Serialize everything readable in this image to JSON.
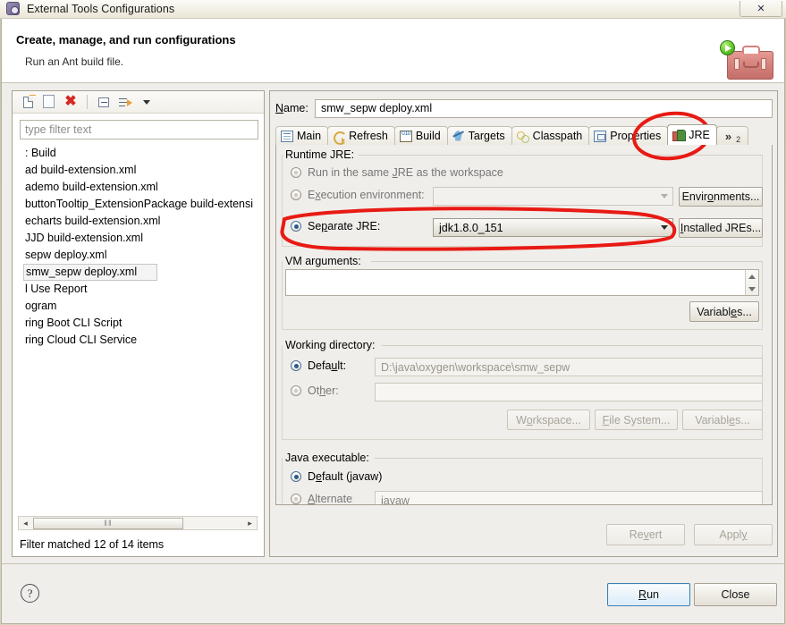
{
  "window": {
    "title": "External Tools Configurations",
    "icon": "gear-icon",
    "close_label": "✕"
  },
  "header": {
    "title": "Create, manage, and run configurations",
    "subtitle": "Run an Ant build file.",
    "hero_icon": "toolbox-with-run-icon"
  },
  "left_panel": {
    "toolbar": [
      {
        "name": "new-configuration-icon",
        "glyph": "new-doc"
      },
      {
        "name": "duplicate-configuration-icon",
        "glyph": "copy"
      },
      {
        "name": "delete-configuration-icon",
        "glyph": "red-x"
      },
      {
        "name": "collapse-all-icon",
        "glyph": "collapse"
      },
      {
        "name": "filter-configurations-icon",
        "glyph": "filter"
      },
      {
        "name": "view-menu-chevron-icon",
        "glyph": "caret-down"
      }
    ],
    "filter": {
      "placeholder": "type filter text",
      "value": ""
    },
    "items": [
      {
        "label": ": Build",
        "selected": false
      },
      {
        "label": "ad build-extension.xml",
        "selected": false
      },
      {
        "label": "ademo build-extension.xml",
        "selected": false
      },
      {
        "label": "buttonTooltip_ExtensionPackage build-extensi",
        "selected": false
      },
      {
        "label": "echarts build-extension.xml",
        "selected": false
      },
      {
        "label": "JJD build-extension.xml",
        "selected": false
      },
      {
        "label": "sepw deploy.xml",
        "selected": false
      },
      {
        "label": "smw_sepw deploy.xml",
        "selected": true
      },
      {
        "label": "l Use Report",
        "selected": false
      },
      {
        "label": "ogram",
        "selected": false
      },
      {
        "label": "ring Boot CLI Script",
        "selected": false
      },
      {
        "label": "ring Cloud CLI Service",
        "selected": false
      }
    ],
    "hscroll": {
      "left_arrow": "◂",
      "right_arrow": "▸",
      "thumb_grip": "‖‖"
    },
    "status": "Filter matched 12 of 14 items"
  },
  "right_panel": {
    "name_label": "Name:",
    "name_label_mnemonic": "N",
    "name_value": "smw_sepw deploy.xml",
    "tabs": [
      {
        "label": "Main",
        "icon": "main-tab-icon",
        "active": false
      },
      {
        "label": "Refresh",
        "icon": "refresh-tab-icon",
        "active": false
      },
      {
        "label": "Build",
        "icon": "build-tab-icon",
        "active": false
      },
      {
        "label": "Targets",
        "icon": "targets-tab-icon",
        "active": false
      },
      {
        "label": "Classpath",
        "icon": "classpath-tab-icon",
        "active": false
      },
      {
        "label": "Properties",
        "icon": "properties-tab-icon",
        "active": false
      },
      {
        "label": "JRE",
        "icon": "jre-tab-icon",
        "active": true
      }
    ],
    "tab_overflow": {
      "chevron": "»",
      "count": "2"
    },
    "jre_tab": {
      "runtime_group_title": "Runtime JRE:",
      "option_same_jre": {
        "label": "Run in the same JRE as the workspace",
        "mnemonic": "J",
        "selected": false,
        "disabled": true
      },
      "option_exec_env": {
        "label": "Execution environment:",
        "mnemonic": "x",
        "selected": false,
        "disabled": true,
        "combo_value": ""
      },
      "environments_button": "Environments...",
      "environments_button_mnemonic": "o",
      "option_separate_jre": {
        "label": "Separate JRE:",
        "mnemonic": "p",
        "selected": true,
        "combo_value": "jdk1.8.0_151"
      },
      "installed_jres_button": "Installed JREs...",
      "installed_jres_button_mnemonic": "I",
      "vm_args_group_title": "VM arguments:",
      "vm_args_mnemonic": "g",
      "vm_args_value": "",
      "vm_args_variables_button": "Variables...",
      "working_dir_group_title": "Working directory:",
      "working_dir_default": {
        "label": "Default:",
        "mnemonic": "u",
        "selected": true,
        "value": "D:\\java\\oxygen\\workspace\\smw_sepw"
      },
      "working_dir_other": {
        "label": "Other:",
        "mnemonic": "h",
        "selected": false,
        "value": ""
      },
      "workspace_button": "Workspace...",
      "workspace_button_mnemonic": "o",
      "file_system_button": "File System...",
      "file_system_button_mnemonic": "F",
      "wd_variables_button": "Variables...",
      "wd_variables_button_mnemonic": "e",
      "java_exec_group_title": "Java executable:",
      "java_exec_default": {
        "label": "Default (javaw)",
        "mnemonic": "e",
        "selected": true
      },
      "java_exec_alternate": {
        "label": "Alternate",
        "mnemonic": "A",
        "selected": false,
        "value": "javaw"
      }
    },
    "revert_button": "Revert",
    "revert_button_mnemonic": "v",
    "revert_disabled": true,
    "apply_button": "Apply",
    "apply_button_mnemonic": "y",
    "apply_disabled": true
  },
  "footer": {
    "help_icon": "?",
    "run_button": "Run",
    "run_button_mnemonic": "R",
    "close_button": "Close"
  },
  "annotations": {
    "color": "#e81a14",
    "marks": [
      {
        "name": "circle-around-jre-tab",
        "shape": "ellipse"
      },
      {
        "name": "circle-around-separate-jre-row",
        "shape": "ellipse"
      }
    ]
  }
}
